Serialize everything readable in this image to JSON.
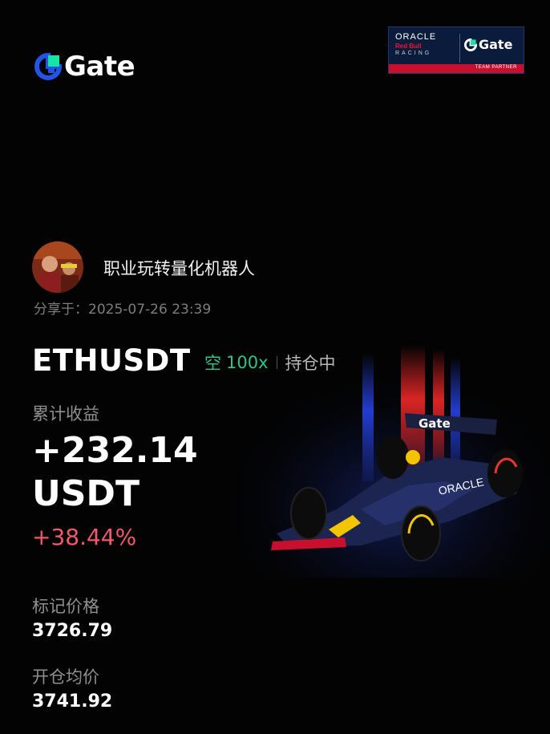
{
  "brand": {
    "name": "Gate",
    "logo_icon": "gate-logo-icon",
    "accent": "#2354e6",
    "accent2": "#17e3a6"
  },
  "partner_badge": {
    "oracle": "ORACLE",
    "redbull": "Red Bull",
    "racing": "RACING",
    "gate": "Gate",
    "tagline": "TEAM PARTNER"
  },
  "user": {
    "name": "职业玩转量化机器人",
    "shared_at": "分享于：2025-07-26 23:39"
  },
  "position": {
    "pair": "ETHUSDT",
    "side": "空",
    "leverage": "100x",
    "status": "持仓中",
    "side_color": "#2ec48b"
  },
  "pnl": {
    "label": "累计收益",
    "value": "+232.14",
    "unit": "USDT",
    "percent": "+38.44%",
    "percent_color": "#ef5a6b"
  },
  "prices": {
    "mark_label": "标记价格",
    "mark_value": "3726.79",
    "open_label": "开仓均价",
    "open_value": "3741.92"
  },
  "car_livery": {
    "text": "Gate",
    "sponsor": "ORACLE"
  }
}
